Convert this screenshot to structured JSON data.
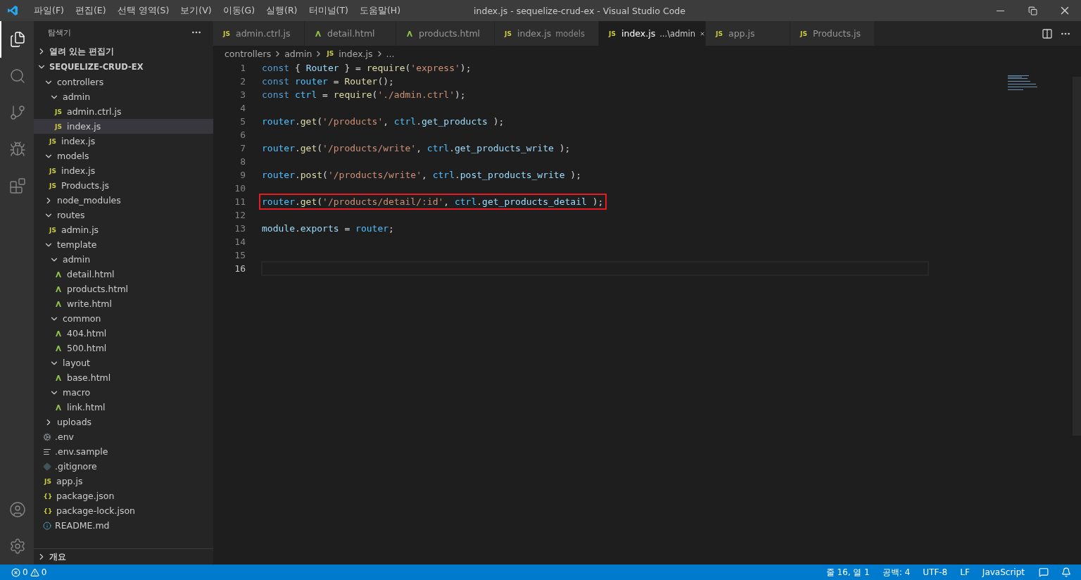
{
  "window": {
    "title": "index.js - sequelize-crud-ex - Visual Studio Code"
  },
  "menu": [
    "파일(F)",
    "편집(E)",
    "선택 영역(S)",
    "보기(V)",
    "이동(G)",
    "실행(R)",
    "터미널(T)",
    "도움말(H)"
  ],
  "activity_bar": [
    {
      "kind": "files",
      "selected": true
    },
    {
      "kind": "search",
      "selected": false
    },
    {
      "kind": "source-control",
      "selected": false
    },
    {
      "kind": "run",
      "selected": false
    },
    {
      "kind": "extensions",
      "selected": false
    }
  ],
  "explorer": {
    "title": "탐색기",
    "open_editors": {
      "label": "열려 있는 편집기",
      "expanded": false
    },
    "project": {
      "label": "SEQUELIZE-CRUD-EX",
      "expanded": true
    },
    "tree": [
      {
        "kind": "folder",
        "label": "controllers",
        "expanded": true,
        "selected": false,
        "children": [
          {
            "kind": "folder",
            "label": "admin",
            "expanded": true,
            "selected": false,
            "children": [
              {
                "kind": "js",
                "badge": "JS",
                "label": "admin.ctrl.js",
                "selected": false
              },
              {
                "kind": "js",
                "badge": "JS",
                "label": "index.js",
                "selected": true
              }
            ]
          },
          {
            "kind": "js",
            "badge": "JS",
            "label": "index.js",
            "selected": false
          }
        ]
      },
      {
        "kind": "folder",
        "label": "models",
        "expanded": true,
        "selected": false,
        "children": [
          {
            "kind": "js",
            "badge": "JS",
            "label": "index.js",
            "selected": false
          },
          {
            "kind": "js",
            "badge": "JS",
            "label": "Products.js",
            "selected": false
          }
        ]
      },
      {
        "kind": "folder",
        "label": "node_modules",
        "expanded": false,
        "selected": false
      },
      {
        "kind": "folder",
        "label": "routes",
        "expanded": true,
        "selected": false,
        "children": [
          {
            "kind": "js",
            "badge": "JS",
            "label": "admin.js",
            "selected": false
          }
        ]
      },
      {
        "kind": "folder",
        "label": "template",
        "expanded": true,
        "selected": false,
        "children": [
          {
            "kind": "folder",
            "label": "admin",
            "expanded": true,
            "selected": false,
            "children": [
              {
                "kind": "html",
                "label": "detail.html",
                "selected": false
              },
              {
                "kind": "html",
                "label": "products.html",
                "selected": false
              },
              {
                "kind": "html",
                "label": "write.html",
                "selected": false
              }
            ]
          },
          {
            "kind": "folder",
            "label": "common",
            "expanded": true,
            "selected": false,
            "children": [
              {
                "kind": "html",
                "label": "404.html",
                "selected": false
              },
              {
                "kind": "html",
                "label": "500.html",
                "selected": false
              }
            ]
          },
          {
            "kind": "folder",
            "label": "layout",
            "expanded": true,
            "selected": false,
            "children": [
              {
                "kind": "html",
                "label": "base.html",
                "selected": false
              }
            ]
          },
          {
            "kind": "folder",
            "label": "macro",
            "expanded": true,
            "selected": false,
            "children": [
              {
                "kind": "html",
                "label": "link.html",
                "selected": false
              }
            ]
          }
        ]
      },
      {
        "kind": "folder",
        "label": "uploads",
        "expanded": false,
        "selected": false
      },
      {
        "kind": "env",
        "label": ".env",
        "selected": false
      },
      {
        "kind": "text",
        "label": ".env.sample",
        "selected": false
      },
      {
        "kind": "git",
        "label": ".gitignore",
        "selected": false
      },
      {
        "kind": "js",
        "badge": "JS",
        "label": "app.js",
        "selected": false
      },
      {
        "kind": "json",
        "badge": "{}",
        "label": "package.json",
        "selected": false
      },
      {
        "kind": "json",
        "badge": "{}",
        "label": "package-lock.json",
        "selected": false
      },
      {
        "kind": "info",
        "label": "README.md",
        "selected": false
      }
    ],
    "outline": {
      "label": "개요",
      "expanded": false
    }
  },
  "tabs": [
    {
      "kind": "js",
      "badge": "JS",
      "label": "admin.ctrl.js",
      "selected": false
    },
    {
      "kind": "html",
      "label": "detail.html",
      "selected": false
    },
    {
      "kind": "html",
      "label": "products.html",
      "selected": false
    },
    {
      "kind": "js",
      "badge": "JS",
      "label": "index.js",
      "description": "models",
      "selected": false
    },
    {
      "kind": "js",
      "badge": "JS",
      "label": "index.js",
      "description": "...\\admin",
      "selected": true
    },
    {
      "kind": "js",
      "badge": "JS",
      "label": "app.js",
      "selected": false
    },
    {
      "kind": "js",
      "badge": "JS",
      "label": "Products.js",
      "selected": false
    }
  ],
  "breadcrumbs": [
    {
      "label": "controllers"
    },
    {
      "label": "admin"
    },
    {
      "label": "index.js",
      "badge": "JS"
    },
    {
      "label": "..."
    }
  ],
  "code": [
    {
      "number": "1",
      "tokens": [
        {
          "kind": "keyword",
          "text": "const"
        },
        {
          "kind": "punct",
          "text": " { "
        },
        {
          "kind": "variable",
          "text": "Router"
        },
        {
          "kind": "punct",
          "text": " } = "
        },
        {
          "kind": "function",
          "text": "require"
        },
        {
          "kind": "punct",
          "text": "("
        },
        {
          "kind": "string",
          "text": "'express'"
        },
        {
          "kind": "punct",
          "text": ");"
        }
      ]
    },
    {
      "number": "2",
      "tokens": [
        {
          "kind": "keyword",
          "text": "const "
        },
        {
          "kind": "constant",
          "text": "router"
        },
        {
          "kind": "punct",
          "text": " = "
        },
        {
          "kind": "function",
          "text": "Router"
        },
        {
          "kind": "punct",
          "text": "();"
        }
      ]
    },
    {
      "number": "3",
      "tokens": [
        {
          "kind": "keyword",
          "text": "const "
        },
        {
          "kind": "constant",
          "text": "ctrl"
        },
        {
          "kind": "punct",
          "text": " = "
        },
        {
          "kind": "function",
          "text": "require"
        },
        {
          "kind": "punct",
          "text": "("
        },
        {
          "kind": "string",
          "text": "'./admin.ctrl'"
        },
        {
          "kind": "punct",
          "text": ");"
        }
      ]
    },
    {
      "number": "4"
    },
    {
      "number": "5",
      "tokens": [
        {
          "kind": "constant",
          "text": "router"
        },
        {
          "kind": "punct",
          "text": "."
        },
        {
          "kind": "function",
          "text": "get"
        },
        {
          "kind": "punct",
          "text": "("
        },
        {
          "kind": "string",
          "text": "'/products'"
        },
        {
          "kind": "punct",
          "text": ", "
        },
        {
          "kind": "constant",
          "text": "ctrl"
        },
        {
          "kind": "punct",
          "text": "."
        },
        {
          "kind": "variable",
          "text": "get_products"
        },
        {
          "kind": "punct",
          "text": " );"
        }
      ]
    },
    {
      "number": "6"
    },
    {
      "number": "7",
      "tokens": [
        {
          "kind": "constant",
          "text": "router"
        },
        {
          "kind": "punct",
          "text": "."
        },
        {
          "kind": "function",
          "text": "get"
        },
        {
          "kind": "punct",
          "text": "("
        },
        {
          "kind": "string",
          "text": "'/products/write'"
        },
        {
          "kind": "punct",
          "text": ", "
        },
        {
          "kind": "constant",
          "text": "ctrl"
        },
        {
          "kind": "punct",
          "text": "."
        },
        {
          "kind": "variable",
          "text": "get_products_write"
        },
        {
          "kind": "punct",
          "text": " );"
        }
      ]
    },
    {
      "number": "8"
    },
    {
      "number": "9",
      "tokens": [
        {
          "kind": "constant",
          "text": "router"
        },
        {
          "kind": "punct",
          "text": "."
        },
        {
          "kind": "function",
          "text": "post"
        },
        {
          "kind": "punct",
          "text": "("
        },
        {
          "kind": "string",
          "text": "'/products/write'"
        },
        {
          "kind": "punct",
          "text": ", "
        },
        {
          "kind": "constant",
          "text": "ctrl"
        },
        {
          "kind": "punct",
          "text": "."
        },
        {
          "kind": "variable",
          "text": "post_products_write"
        },
        {
          "kind": "punct",
          "text": " );"
        }
      ]
    },
    {
      "number": "10"
    },
    {
      "number": "11",
      "highlighted": true,
      "tokens": [
        {
          "kind": "constant",
          "text": "router"
        },
        {
          "kind": "punct",
          "text": "."
        },
        {
          "kind": "function",
          "text": "get"
        },
        {
          "kind": "punct",
          "text": "("
        },
        {
          "kind": "string",
          "text": "'/products/detail/:id'"
        },
        {
          "kind": "punct",
          "text": ", "
        },
        {
          "kind": "constant",
          "text": "ctrl"
        },
        {
          "kind": "punct",
          "text": "."
        },
        {
          "kind": "variable",
          "text": "get_products_detail"
        },
        {
          "kind": "punct",
          "text": " );"
        }
      ]
    },
    {
      "number": "12"
    },
    {
      "number": "13",
      "tokens": [
        {
          "kind": "variable",
          "text": "module"
        },
        {
          "kind": "punct",
          "text": "."
        },
        {
          "kind": "variable",
          "text": "exports"
        },
        {
          "kind": "punct",
          "text": " = "
        },
        {
          "kind": "constant",
          "text": "router"
        },
        {
          "kind": "punct",
          "text": ";"
        }
      ]
    },
    {
      "number": "14"
    },
    {
      "number": "15"
    },
    {
      "number": "16",
      "current": true
    }
  ],
  "status_bar": {
    "errors": "0",
    "warnings": "0",
    "items": [
      "줄 16, 열 1",
      "공백: 4",
      "UTF-8",
      "LF",
      "JavaScript"
    ]
  }
}
